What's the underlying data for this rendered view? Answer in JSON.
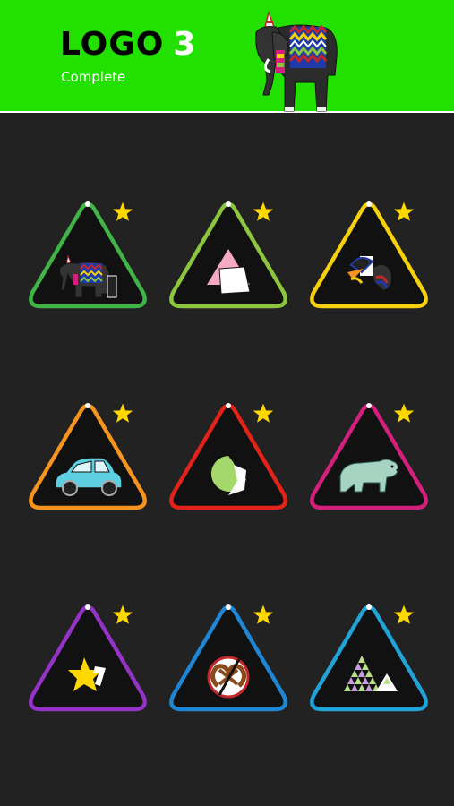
{
  "header": {
    "title": "LOGO",
    "level": "3",
    "status": "Complete",
    "background_color": "#22e000",
    "image": "elephant-logo"
  },
  "levels": [
    {
      "logo": "elephant-logo",
      "border_color": "#3fb548",
      "stars": 1,
      "completed": true
    },
    {
      "logo": "pink-triangle-logo",
      "border_color": "#8cc63f",
      "stars": 1,
      "completed": true
    },
    {
      "logo": "toucan-logo",
      "border_color": "#f6d10b",
      "stars": 1,
      "completed": true
    },
    {
      "logo": "blue-car-logo",
      "border_color": "#f7941d",
      "stars": 1,
      "completed": true
    },
    {
      "logo": "green-circle-logo",
      "border_color": "#e2231a",
      "stars": 1,
      "completed": true
    },
    {
      "logo": "polar-bear-logo",
      "border_color": "#d4207c",
      "stars": 1,
      "completed": true
    },
    {
      "logo": "yellow-star-logo",
      "border_color": "#9333c7",
      "stars": 1,
      "completed": true
    },
    {
      "logo": "pretzel-logo",
      "border_color": "#1f86d6",
      "stars": 1,
      "completed": true
    },
    {
      "logo": "triangles-logo",
      "border_color": "#22a3d8",
      "stars": 1,
      "completed": true
    }
  ],
  "star_color": "#ffd700"
}
